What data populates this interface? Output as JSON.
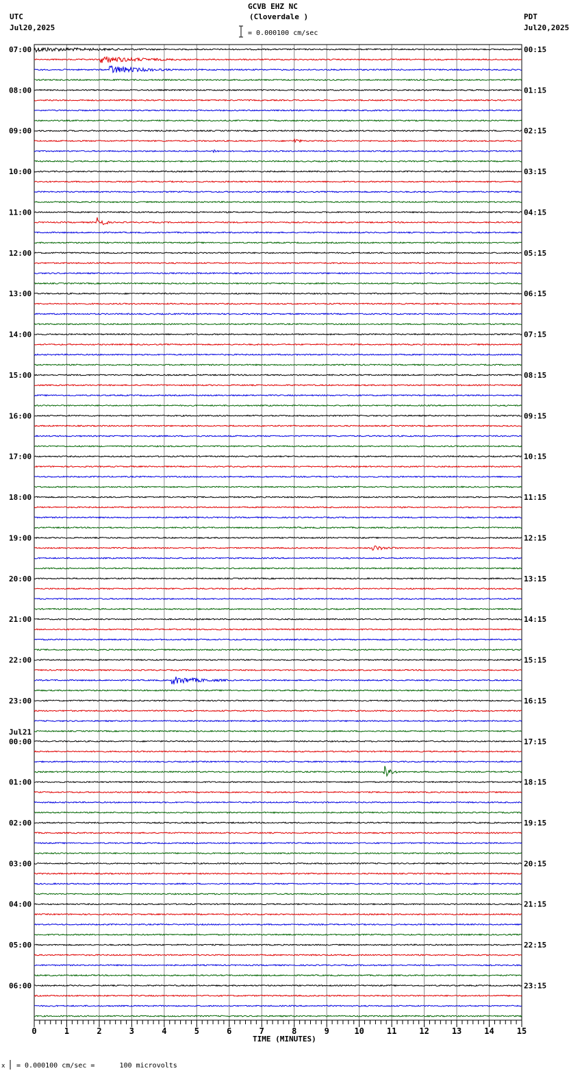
{
  "header": {
    "station": "GCVB EHZ NC",
    "location": "(Cloverdale )",
    "left_tz": "UTC",
    "left_date": "Jul20,2025",
    "right_tz": "PDT",
    "right_date": "Jul20,2025",
    "scale_text": "= 0.000100 cm/sec"
  },
  "footer": {
    "scale_text": "= 0.000100 cm/sec =      100 microvolts",
    "scale_prefix": "x"
  },
  "colors": {
    "trace_cycle": [
      "#000000",
      "#e00000",
      "#0000e0",
      "#006400"
    ],
    "grid": "#888888"
  },
  "chart_data": {
    "type": "line",
    "title": "GCVB EHZ NC (Cloverdale )",
    "xlabel": "TIME (MINUTES)",
    "xlim": [
      0,
      15
    ],
    "x_ticks": [
      "0",
      "1",
      "2",
      "3",
      "4",
      "5",
      "6",
      "7",
      "8",
      "9",
      "10",
      "11",
      "12",
      "13",
      "14",
      "15"
    ],
    "minor_tick_seconds": 10,
    "traces_per_hour": 4,
    "trace_count": 96,
    "left_labels": [
      "07:00",
      "08:00",
      "09:00",
      "10:00",
      "11:00",
      "12:00",
      "13:00",
      "14:00",
      "15:00",
      "16:00",
      "17:00",
      "18:00",
      "19:00",
      "20:00",
      "21:00",
      "22:00",
      "23:00",
      "00:00",
      "01:00",
      "02:00",
      "03:00",
      "04:00",
      "05:00",
      "06:00"
    ],
    "date_change_label": "Jul21",
    "date_change_index": 17,
    "right_labels": [
      "00:15",
      "01:15",
      "02:15",
      "03:15",
      "04:15",
      "05:15",
      "06:15",
      "07:15",
      "08:15",
      "09:15",
      "10:15",
      "11:15",
      "12:15",
      "13:15",
      "14:15",
      "15:15",
      "16:15",
      "17:15",
      "18:15",
      "19:15",
      "20:15",
      "21:15",
      "22:15",
      "23:15"
    ],
    "events": [
      {
        "trace": 0,
        "start_min": 0.0,
        "duration_min": 4.0,
        "amplitude": 3
      },
      {
        "trace": 1,
        "start_min": 2.0,
        "duration_min": 2.5,
        "amplitude": 5
      },
      {
        "trace": 2,
        "start_min": 2.3,
        "duration_min": 2.0,
        "amplitude": 6
      },
      {
        "trace": 2,
        "start_min": 11.5,
        "duration_min": 0.05,
        "amplitude": 5
      },
      {
        "trace": 9,
        "start_min": 8.0,
        "duration_min": 0.3,
        "amplitude": 4
      },
      {
        "trace": 10,
        "start_min": 5.5,
        "duration_min": 0.3,
        "amplitude": 3
      },
      {
        "trace": 17,
        "start_min": 1.9,
        "duration_min": 0.4,
        "amplitude": 13
      },
      {
        "trace": 49,
        "start_min": 10.4,
        "duration_min": 0.8,
        "amplitude": 4
      },
      {
        "trace": 62,
        "start_min": 4.2,
        "duration_min": 1.8,
        "amplitude": 6
      },
      {
        "trace": 71,
        "start_min": 10.75,
        "duration_min": 0.4,
        "amplitude": 14
      }
    ]
  }
}
